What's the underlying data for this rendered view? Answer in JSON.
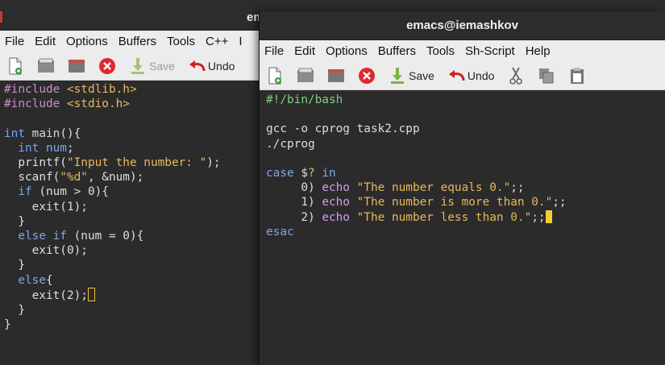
{
  "back_window": {
    "title": "em",
    "menu": [
      "File",
      "Edit",
      "Options",
      "Buffers",
      "Tools",
      "C++",
      "I"
    ],
    "toolbar": {
      "save_label": "Save",
      "undo_label": "Undo"
    },
    "code": [
      [
        [
          "pp",
          "#include "
        ],
        [
          "str",
          "<stdlib.h>"
        ]
      ],
      [
        [
          "pp",
          "#include "
        ],
        [
          "str",
          "<stdio.h>"
        ]
      ],
      [],
      [
        [
          "ty",
          "int "
        ],
        [
          "fn",
          "main"
        ],
        [
          "",
          "(){"
        ]
      ],
      [
        [
          "",
          "  "
        ],
        [
          "ty",
          "int "
        ],
        [
          "kw",
          "num"
        ],
        [
          "",
          ";"
        ]
      ],
      [
        [
          "",
          "  printf("
        ],
        [
          "str",
          "\"Input the number: \""
        ],
        [
          "",
          ");"
        ]
      ],
      [
        [
          "",
          "  scanf("
        ],
        [
          "str",
          "\"%d\""
        ],
        [
          "",
          ", &num);"
        ]
      ],
      [
        [
          "",
          "  "
        ],
        [
          "kw",
          "if"
        ],
        [
          "",
          " (num > 0){"
        ]
      ],
      [
        [
          "",
          "    exit(1);"
        ]
      ],
      [
        [
          "",
          "  }"
        ]
      ],
      [
        [
          "",
          "  "
        ],
        [
          "kw",
          "else if"
        ],
        [
          "",
          " (num = 0){"
        ]
      ],
      [
        [
          "",
          "    exit(0);"
        ]
      ],
      [
        [
          "",
          "  }"
        ]
      ],
      [
        [
          "",
          "  "
        ],
        [
          "kw",
          "else"
        ],
        [
          "",
          "{"
        ]
      ],
      [
        [
          "",
          "    exit(2);"
        ],
        [
          "cursor-hollow",
          ""
        ]
      ],
      [
        [
          "",
          "  }"
        ]
      ],
      [
        [
          "",
          "}"
        ]
      ]
    ]
  },
  "front_window": {
    "title": "emacs@iemashkov",
    "menu": [
      "File",
      "Edit",
      "Options",
      "Buffers",
      "Tools",
      "Sh-Script",
      "Help"
    ],
    "toolbar": {
      "save_label": "Save",
      "undo_label": "Undo"
    },
    "code": [
      [
        [
          "sheb",
          "#!/bin/bash"
        ]
      ],
      [],
      [
        [
          "",
          "gcc -o cprog task2.cpp"
        ]
      ],
      [
        [
          "",
          "./cprog"
        ]
      ],
      [],
      [
        [
          "kw",
          "case"
        ],
        [
          "",
          " $"
        ],
        [
          "str",
          "?"
        ],
        [
          "",
          " "
        ],
        [
          "kw",
          "in"
        ]
      ],
      [
        [
          "",
          "     0) "
        ],
        [
          "kw2",
          "echo"
        ],
        [
          "",
          " "
        ],
        [
          "str",
          "\"The number equals 0.\""
        ],
        [
          "",
          ";;"
        ]
      ],
      [
        [
          "",
          "     1) "
        ],
        [
          "kw2",
          "echo"
        ],
        [
          "",
          " "
        ],
        [
          "str",
          "\"The number is more than 0.\""
        ],
        [
          "",
          ";;"
        ]
      ],
      [
        [
          "",
          "     2) "
        ],
        [
          "kw2",
          "echo"
        ],
        [
          "",
          " "
        ],
        [
          "str",
          "\"The number less than 0.\""
        ],
        [
          "",
          ";;"
        ],
        [
          "cursor-solid",
          ""
        ]
      ],
      [
        [
          "kw",
          "esac"
        ]
      ]
    ]
  }
}
